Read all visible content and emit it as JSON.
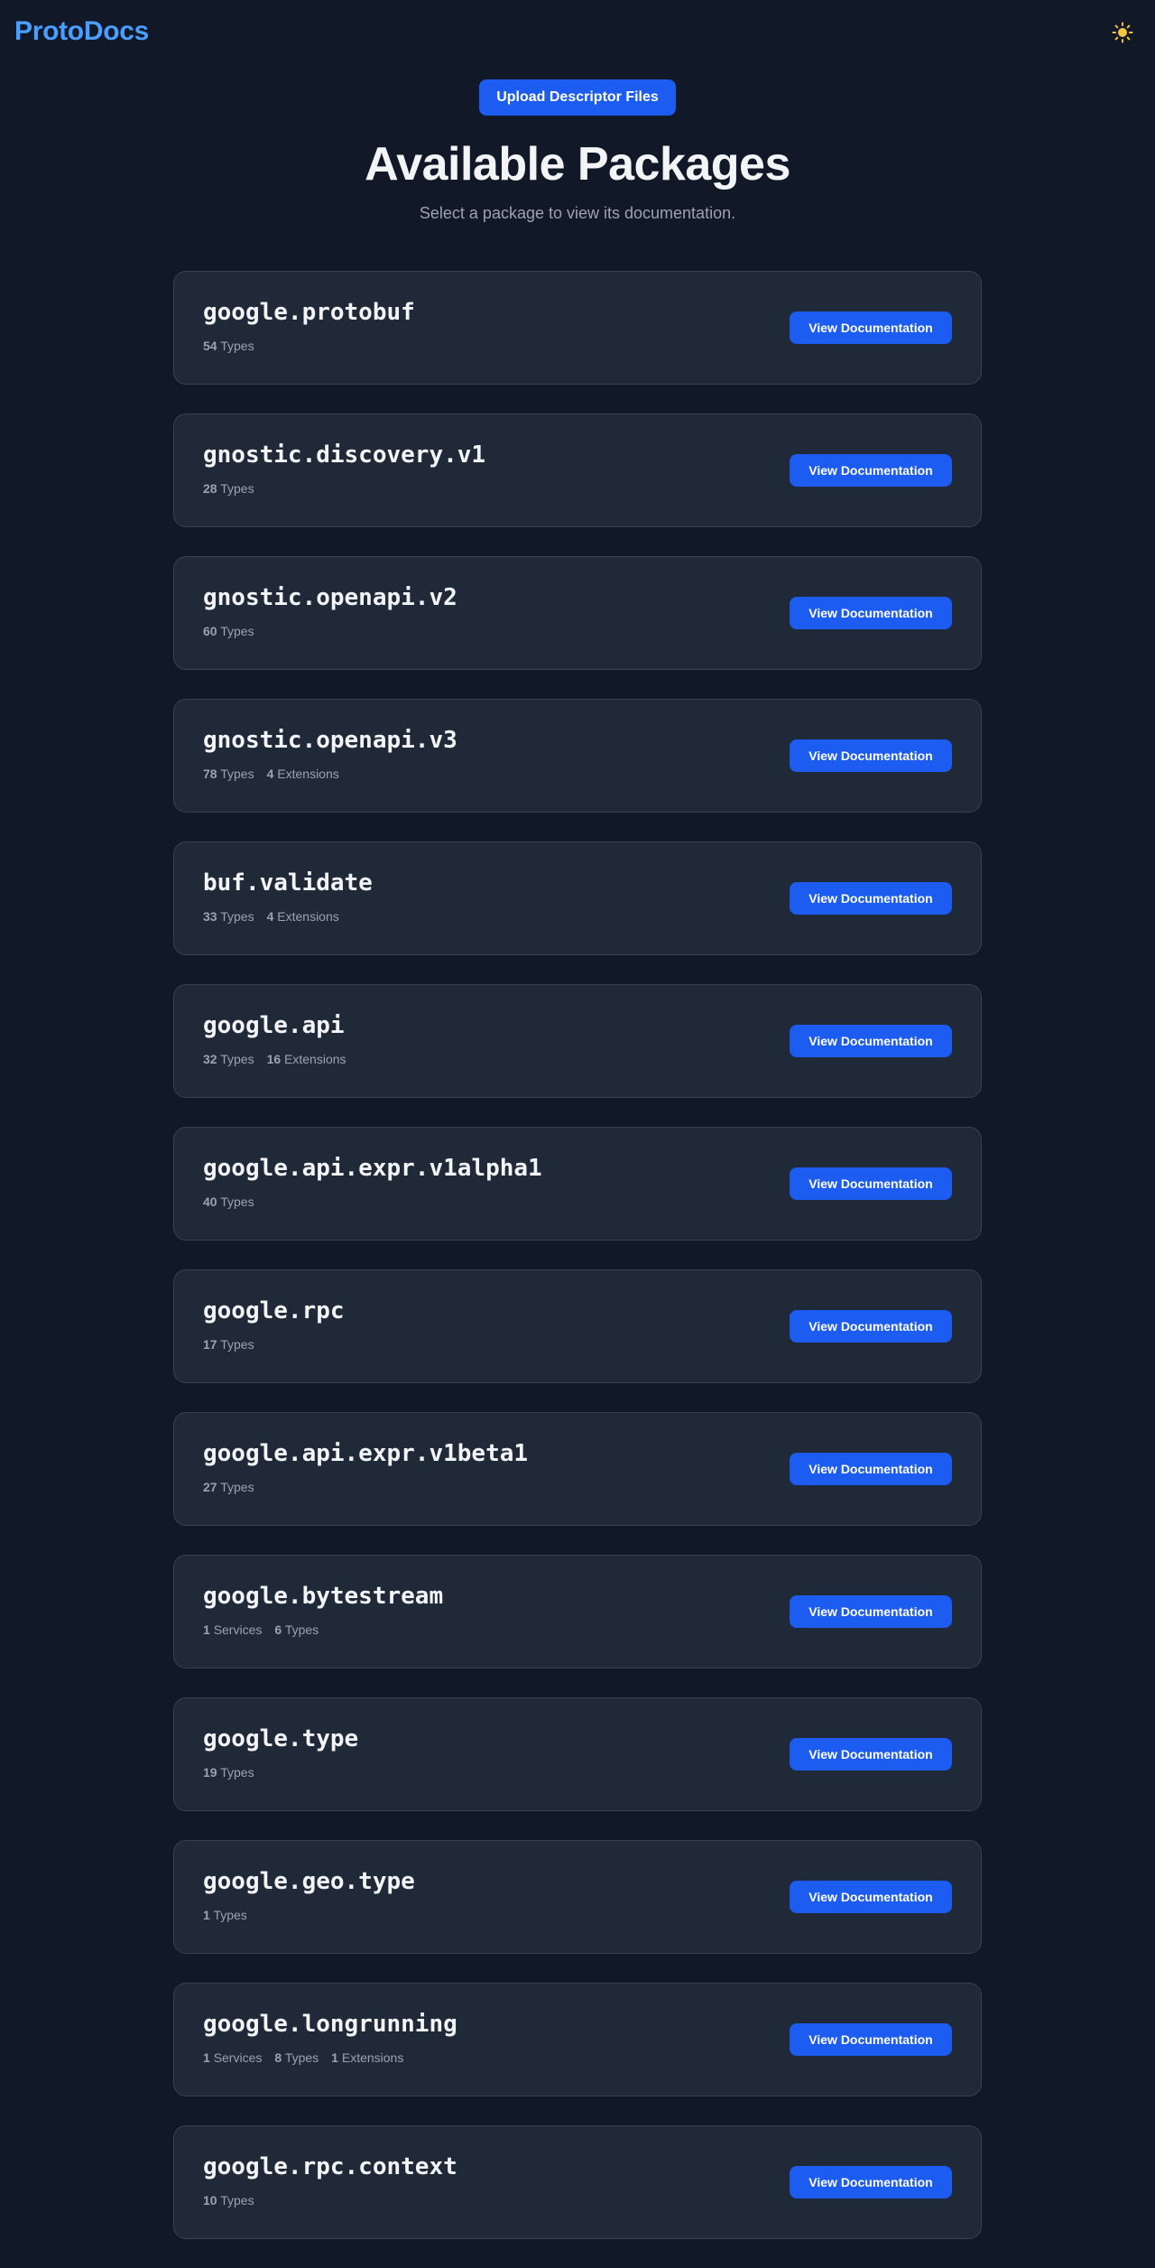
{
  "header": {
    "logo": "ProtoDocs",
    "theme_icon": "sun-icon",
    "theme_icon_color": "#f5c542"
  },
  "upload_button_label": "Upload Descriptor Files",
  "page_title": "Available Packages",
  "page_subtitle": "Select a package to view its documentation.",
  "colors": {
    "background": "#111827",
    "card": "#1f2937",
    "accent": "#1d5cf0",
    "logo": "#4a9eff"
  },
  "view_button_label": "View Documentation",
  "packages": [
    {
      "name": "google.protobuf",
      "stats": [
        {
          "count": "54",
          "label": "Types"
        }
      ]
    },
    {
      "name": "gnostic.discovery.v1",
      "stats": [
        {
          "count": "28",
          "label": "Types"
        }
      ]
    },
    {
      "name": "gnostic.openapi.v2",
      "stats": [
        {
          "count": "60",
          "label": "Types"
        }
      ]
    },
    {
      "name": "gnostic.openapi.v3",
      "stats": [
        {
          "count": "78",
          "label": "Types"
        },
        {
          "count": "4",
          "label": "Extensions"
        }
      ]
    },
    {
      "name": "buf.validate",
      "stats": [
        {
          "count": "33",
          "label": "Types"
        },
        {
          "count": "4",
          "label": "Extensions"
        }
      ]
    },
    {
      "name": "google.api",
      "stats": [
        {
          "count": "32",
          "label": "Types"
        },
        {
          "count": "16",
          "label": "Extensions"
        }
      ]
    },
    {
      "name": "google.api.expr.v1alpha1",
      "stats": [
        {
          "count": "40",
          "label": "Types"
        }
      ]
    },
    {
      "name": "google.rpc",
      "stats": [
        {
          "count": "17",
          "label": "Types"
        }
      ]
    },
    {
      "name": "google.api.expr.v1beta1",
      "stats": [
        {
          "count": "27",
          "label": "Types"
        }
      ]
    },
    {
      "name": "google.bytestream",
      "stats": [
        {
          "count": "1",
          "label": "Services"
        },
        {
          "count": "6",
          "label": "Types"
        }
      ]
    },
    {
      "name": "google.type",
      "stats": [
        {
          "count": "19",
          "label": "Types"
        }
      ]
    },
    {
      "name": "google.geo.type",
      "stats": [
        {
          "count": "1",
          "label": "Types"
        }
      ]
    },
    {
      "name": "google.longrunning",
      "stats": [
        {
          "count": "1",
          "label": "Services"
        },
        {
          "count": "8",
          "label": "Types"
        },
        {
          "count": "1",
          "label": "Extensions"
        }
      ]
    },
    {
      "name": "google.rpc.context",
      "stats": [
        {
          "count": "10",
          "label": "Types"
        }
      ]
    }
  ]
}
